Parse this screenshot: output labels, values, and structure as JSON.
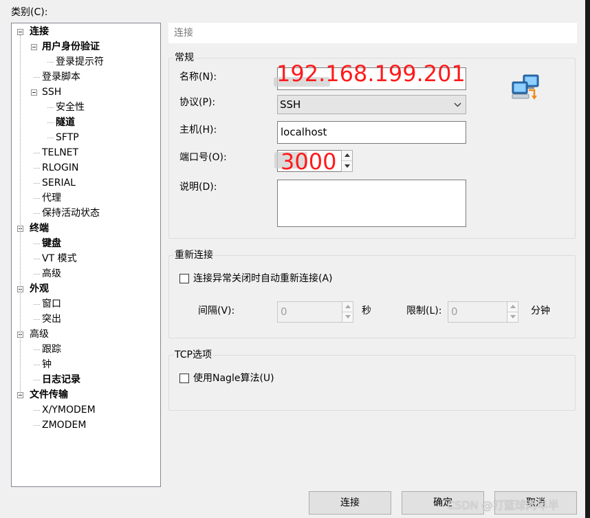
{
  "category_label": "类别(C):",
  "tree": [
    {
      "label": "连接",
      "bold": true,
      "level": 0,
      "expander": true
    },
    {
      "label": "用户身份验证",
      "bold": true,
      "level": 1,
      "expander": true
    },
    {
      "label": "登录提示符",
      "bold": false,
      "level": 2,
      "expander": false
    },
    {
      "label": "登录脚本",
      "bold": false,
      "level": 1,
      "expander": false
    },
    {
      "label": "SSH",
      "bold": false,
      "level": 1,
      "expander": true
    },
    {
      "label": "安全性",
      "bold": false,
      "level": 2,
      "expander": false
    },
    {
      "label": "隧道",
      "bold": true,
      "level": 2,
      "expander": false
    },
    {
      "label": "SFTP",
      "bold": false,
      "level": 2,
      "expander": false
    },
    {
      "label": "TELNET",
      "bold": false,
      "level": 1,
      "expander": false
    },
    {
      "label": "RLOGIN",
      "bold": false,
      "level": 1,
      "expander": false
    },
    {
      "label": "SERIAL",
      "bold": false,
      "level": 1,
      "expander": false
    },
    {
      "label": "代理",
      "bold": false,
      "level": 1,
      "expander": false
    },
    {
      "label": "保持活动状态",
      "bold": false,
      "level": 1,
      "expander": false
    },
    {
      "label": "终端",
      "bold": true,
      "level": 0,
      "expander": true
    },
    {
      "label": "键盘",
      "bold": true,
      "level": 1,
      "expander": false
    },
    {
      "label": "VT 模式",
      "bold": false,
      "level": 1,
      "expander": false
    },
    {
      "label": "高级",
      "bold": false,
      "level": 1,
      "expander": false
    },
    {
      "label": "外观",
      "bold": true,
      "level": 0,
      "expander": true
    },
    {
      "label": "窗口",
      "bold": false,
      "level": 1,
      "expander": false
    },
    {
      "label": "突出",
      "bold": false,
      "level": 1,
      "expander": false
    },
    {
      "label": "高级",
      "bold": false,
      "level": 0,
      "expander": true
    },
    {
      "label": "跟踪",
      "bold": false,
      "level": 1,
      "expander": false
    },
    {
      "label": "钟",
      "bold": false,
      "level": 1,
      "expander": false
    },
    {
      "label": "日志记录",
      "bold": true,
      "level": 1,
      "expander": false
    },
    {
      "label": "文件传输",
      "bold": true,
      "level": 0,
      "expander": true
    },
    {
      "label": "X/YMODEM",
      "bold": false,
      "level": 1,
      "expander": false
    },
    {
      "label": "ZMODEM",
      "bold": false,
      "level": 1,
      "expander": false
    }
  ],
  "page_title": "连接",
  "general": {
    "title": "常规",
    "name_label": "名称(N):",
    "name_value": "",
    "protocol_label": "协议(P):",
    "protocol_value": "SSH",
    "host_label": "主机(H):",
    "host_value": "localhost",
    "port_label": "端口号(O):",
    "port_value": "",
    "desc_label": "说明(D):",
    "desc_value": ""
  },
  "annotations": {
    "ip": "192.168.199.201",
    "port": "3000"
  },
  "reconnect": {
    "title": "重新连接",
    "checkbox_label": "连接异常关闭时自动重新连接(A)",
    "interval_label": "间隔(V):",
    "interval_value": "0",
    "interval_unit": "秒",
    "limit_label": "限制(L):",
    "limit_value": "0",
    "limit_unit": "分钟"
  },
  "tcp": {
    "title": "TCP选项",
    "nagle_label": "使用Nagle算法(U)"
  },
  "buttons": {
    "connect": "连接",
    "ok": "确定",
    "cancel": "取消"
  },
  "watermark": "CSDN @打篮球两年半"
}
